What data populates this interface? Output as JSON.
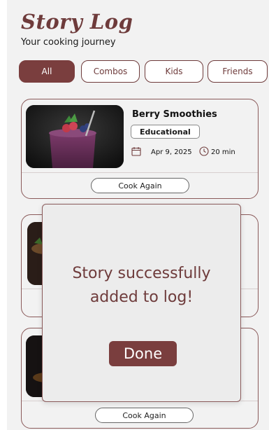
{
  "header": {
    "title": "Story Log",
    "subtitle": "Your cooking journey"
  },
  "filters": [
    {
      "label": "All",
      "active": true
    },
    {
      "label": "Combos",
      "active": false
    },
    {
      "label": "Kids",
      "active": false
    },
    {
      "label": "Friends",
      "active": false
    }
  ],
  "cards": [
    {
      "title": "Berry Smoothies",
      "tag": "Educational",
      "date": "Apr 9, 2025",
      "duration": "20 min",
      "action": "Cook Again"
    },
    {
      "action": "Cook Again"
    }
  ],
  "modal": {
    "message": "Story successfully added to log!",
    "button": "Done"
  },
  "colors": {
    "accent": "#7a3e3e",
    "title": "#6e3b3b"
  }
}
